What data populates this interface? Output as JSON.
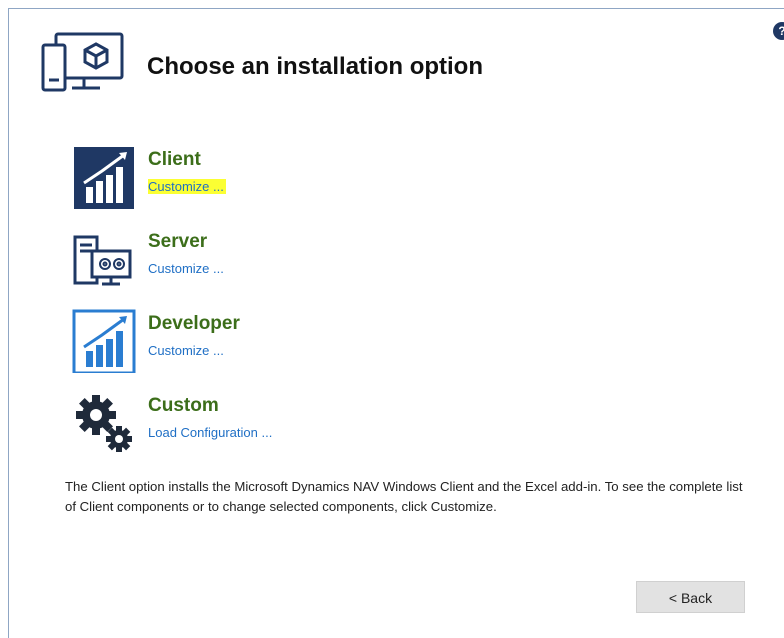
{
  "header": {
    "title": "Choose an installation option",
    "help_glyph": "?",
    "icon": "computer-package-icon"
  },
  "options": [
    {
      "name": "Client",
      "link": "Customize ...",
      "link_highlighted": true,
      "icon": "client-chart-icon"
    },
    {
      "name": "Server",
      "link": "Customize ...",
      "link_highlighted": false,
      "icon": "server-icon"
    },
    {
      "name": "Developer",
      "link": "Customize ...",
      "link_highlighted": false,
      "icon": "developer-chart-icon"
    },
    {
      "name": "Custom",
      "link": "Load Configuration ...",
      "link_highlighted": false,
      "icon": "gears-icon"
    }
  ],
  "description": "The Client option installs the Microsoft Dynamics NAV Windows Client and the Excel add-in.  To see the complete list of Client components or to change selected components, click Customize.",
  "footer": {
    "back_label": "< Back"
  },
  "colors": {
    "option_title": "#3c6e1a",
    "link": "#1f6fc5",
    "highlight": "#fbff33",
    "icon_navy": "#1f3864",
    "icon_blue": "#2a7dd1"
  }
}
